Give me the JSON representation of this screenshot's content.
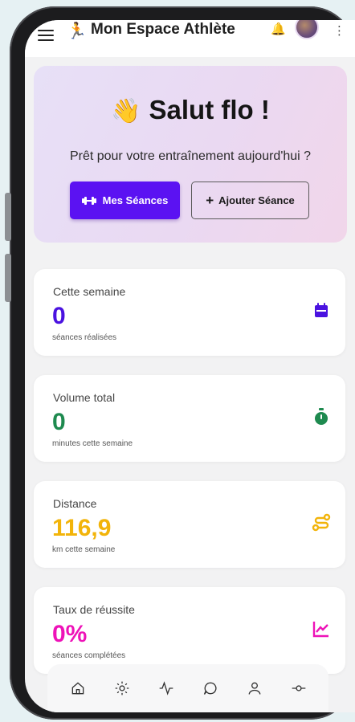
{
  "header": {
    "title": "Mon Espace Athlète",
    "runner_icon": "runner-icon",
    "notification_icon": "bell-icon"
  },
  "hero": {
    "greeting": "Salut flo !",
    "wave_icon": "waving-hand-icon",
    "subtitle": "Prêt pour votre entraînement aujourd'hui ?",
    "primary_button": "Mes Séances",
    "secondary_button": "Ajouter Séance"
  },
  "stats": [
    {
      "label": "Cette semaine",
      "value": "0",
      "sub": "séances réalisées",
      "color": "#4a12e0",
      "icon": "calendar-icon"
    },
    {
      "label": "Volume total",
      "value": "0",
      "sub": "minutes cette semaine",
      "color": "#1e8a4f",
      "icon": "stopwatch-icon"
    },
    {
      "label": "Distance",
      "value": "116,9",
      "sub": "km cette semaine",
      "color": "#f2b40a",
      "icon": "route-icon"
    },
    {
      "label": "Taux de réussite",
      "value": "0%",
      "sub": "séances complétées",
      "color": "#ee12b8",
      "icon": "chart-line-icon"
    }
  ],
  "nav": [
    "home-icon",
    "sun-icon",
    "activity-icon",
    "chat-icon",
    "user-icon",
    "commit-icon"
  ],
  "colors": {
    "accent": "#5b12f2"
  }
}
